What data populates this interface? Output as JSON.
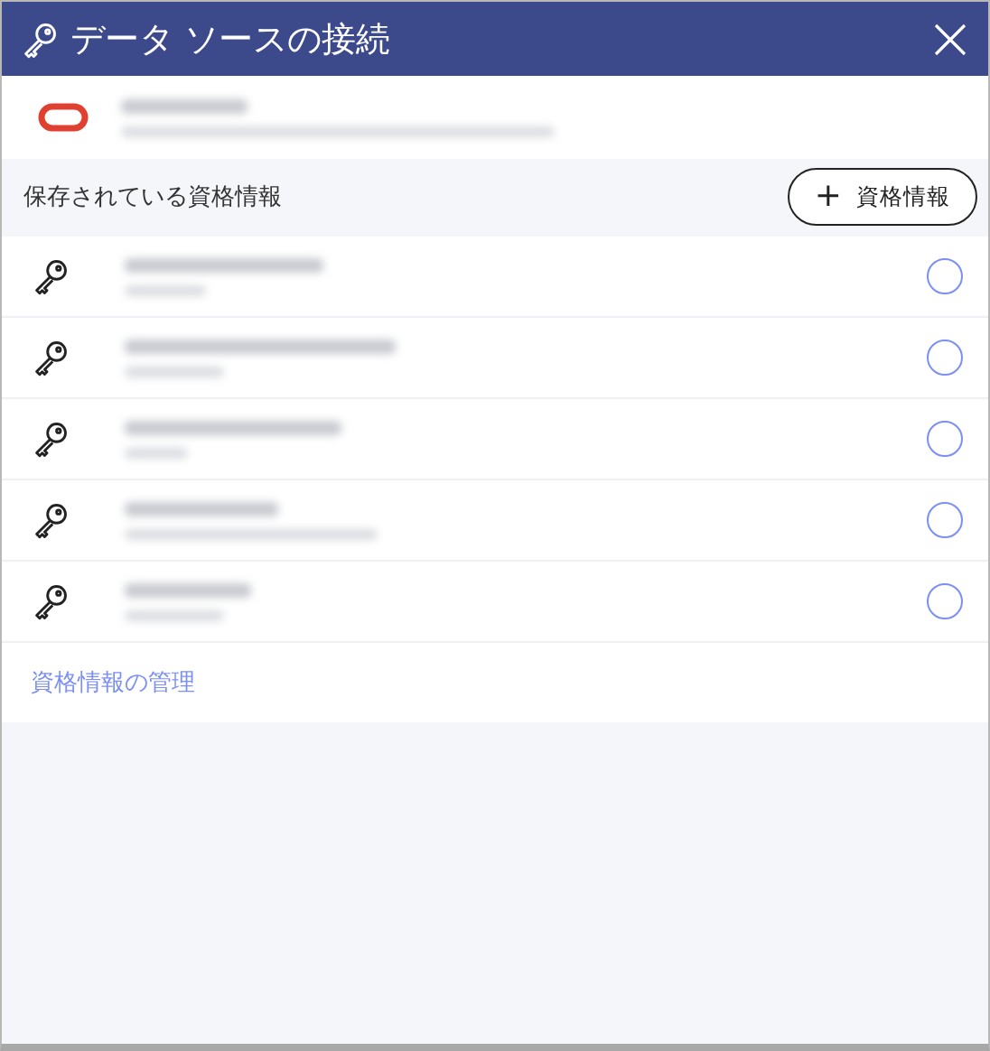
{
  "window": {
    "title": "データ ソースの接続"
  },
  "saved_credentials": {
    "heading": "保存されている資格情報",
    "add_button": {
      "icon": "+",
      "label": "資格情報"
    },
    "items": [
      {
        "selected": false
      },
      {
        "selected": false
      },
      {
        "selected": false
      },
      {
        "selected": false
      },
      {
        "selected": false
      }
    ]
  },
  "manage_link": "資格情報の管理"
}
